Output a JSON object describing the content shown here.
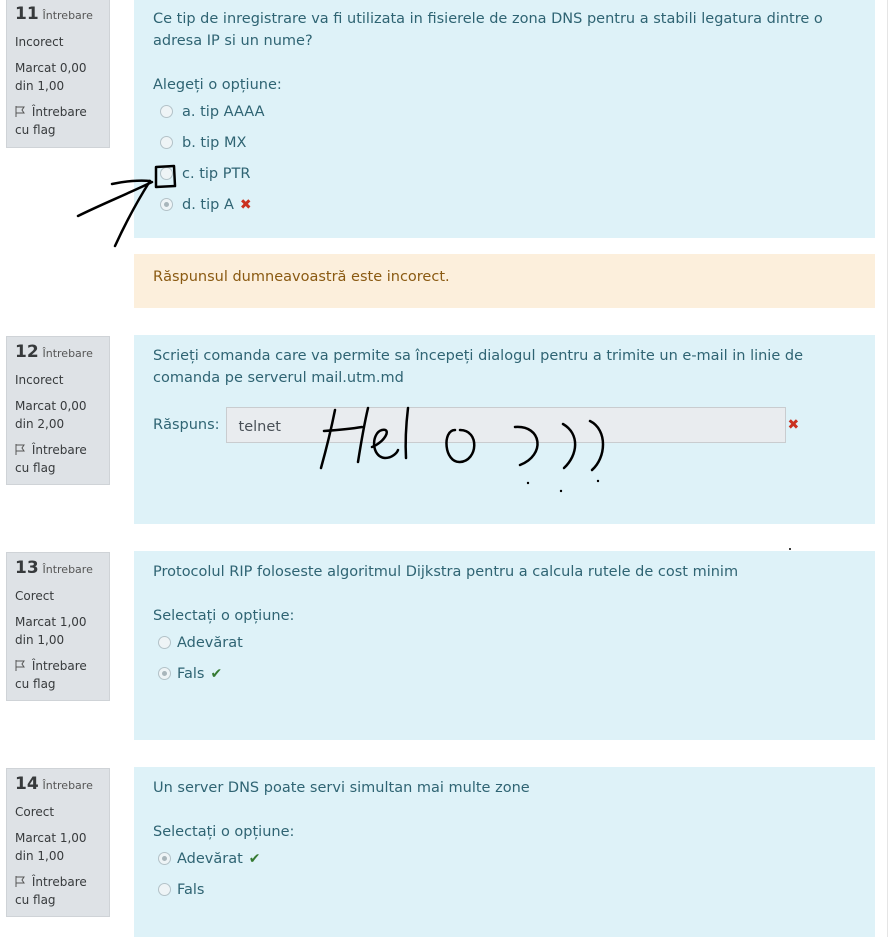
{
  "questions": [
    {
      "number": "11",
      "question_label": "Întrebare",
      "status": "Incorect",
      "mark": "Marcat 0,00 din 1,00",
      "flag_label": "Întrebare cu flag",
      "text": "Ce tip de inregistrare va fi utilizata in fisierele de zona DNS pentru a stabili legatura dintre o adresa IP si un nume?",
      "prompt": "Alegeți o opțiune:",
      "options": [
        {
          "label": "a. tip AAAA",
          "selected": false,
          "mark": ""
        },
        {
          "label": "b. tip MX",
          "selected": false,
          "mark": ""
        },
        {
          "label": "c. tip PTR",
          "selected": false,
          "mark": ""
        },
        {
          "label": "d. tip A",
          "selected": true,
          "mark": "incorrect"
        }
      ],
      "feedback": "Răspunsul dumneavoastră este incorect."
    },
    {
      "number": "12",
      "question_label": "Întrebare",
      "status": "Incorect",
      "mark": "Marcat 0,00 din 2,00",
      "flag_label": "Întrebare cu flag",
      "text": "Scrieți comanda care va permite sa începeți dialogul pentru a trimite un e-mail  in linie de comanda pe serverul mail.utm.md",
      "answer_label": "Răspuns:",
      "answer_value": "telnet",
      "answer_mark": "incorrect"
    },
    {
      "number": "13",
      "question_label": "Întrebare",
      "status": "Corect",
      "mark": "Marcat 1,00 din 1,00",
      "flag_label": "Întrebare cu flag",
      "text": "Protocolul RIP foloseste algoritmul Dijkstra pentru a calcula rutele de cost minim",
      "prompt": "Selectați o opțiune:",
      "options": [
        {
          "label": "Adevărat",
          "selected": false,
          "mark": ""
        },
        {
          "label": "Fals",
          "selected": true,
          "mark": "correct"
        }
      ]
    },
    {
      "number": "14",
      "question_label": "Întrebare",
      "status": "Corect",
      "mark": "Marcat 1,00 din 1,00",
      "flag_label": "Întrebare cu flag",
      "text": "Un server DNS poate servi simultan mai multe zone",
      "prompt": "Selectați o opțiune:",
      "options": [
        {
          "label": "Adevărat",
          "selected": true,
          "mark": "correct"
        },
        {
          "label": "Fals",
          "selected": false,
          "mark": ""
        }
      ]
    }
  ],
  "annotation": {
    "handwritten_text": "Helo )))",
    "shape": "arrow pointing to option c"
  },
  "colors": {
    "question_bg": "#def2f8",
    "info_bg": "#dee2e6",
    "feedback_bg": "#fcefdc",
    "incorrect": "#ca3120",
    "correct": "#357a32"
  }
}
